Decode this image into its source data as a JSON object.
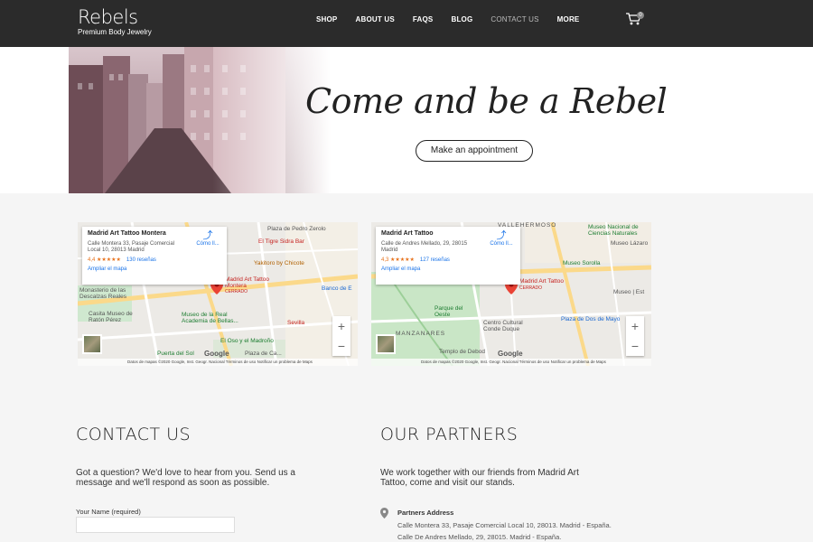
{
  "header": {
    "logo_main": "Rebels",
    "logo_sub": "Premium Body Jewelry",
    "nav": [
      "SHOP",
      "ABOUT US",
      "FAQS",
      "BLOG",
      "CONTACT US",
      "MORE"
    ],
    "active_nav": "CONTACT US",
    "cart_icon": "cart-icon",
    "cart_count": "0"
  },
  "hero": {
    "title": "Come and be a Rebel",
    "button": "Make an appointment"
  },
  "maps": [
    {
      "name": "Madrid Art Tattoo Montera",
      "address": "Calle Montera 33, Pasaje Comercial Local 10, 28013 Madrid",
      "rating": "4,4 ★★★★★",
      "reviews": "130 reseñas",
      "enlarge": "Ampliar el mapa",
      "directions": "Cómo ll...",
      "pin_label": "Madrid Art Tattoo Montera",
      "pin_status": "CERRADO",
      "places": [
        "Plaza de Pedro Zerolo",
        "El Tigre Sidra Bar",
        "Yakitoro by Chicote",
        "Banco de E",
        "Monasterio de las Descalzas Reales",
        "Casita Museo de Ratón Pérez",
        "Museo de la Real Academia de Bellas...",
        "Sevilla",
        "El Oso y el Madroño",
        "Puerta del Sol",
        "Plaza de Ca..."
      ],
      "footer": "Datos de mapas ©2020 Google, Inst. Geogr. Nacional    Términos de uso    Notificar un problema de Maps"
    },
    {
      "name": "Madrid Art Tattoo",
      "address": "Calle de Andres Mellado, 29, 28015 Madrid",
      "rating": "4,3 ★★★★★",
      "reviews": "127 reseñas",
      "enlarge": "Ampliar el mapa",
      "directions": "Cómo ll...",
      "pin_label": "Madrid Art Tattoo",
      "pin_status": "CERRADO",
      "places": [
        "VALLEHERMOSO",
        "Museo Nacional de Ciencias Naturales",
        "Museo Lázaro",
        "Museo Sorolla",
        "Museo | Est",
        "Parque del Oeste",
        "Centro Cultural Conde Duque",
        "Plaza de Dos de Mayo",
        "Templo de Debod",
        "MANZANARES"
      ],
      "footer": "Datos de mapas ©2020 Google, Inst. Geogr. Nacional    Términos de uso    Notificar un problema de Maps"
    }
  ],
  "contact": {
    "title": "CONTACT US",
    "text": "Got a question? We'd love to hear from you. Send us a message and we'll respond as soon as possible.",
    "name_label": "Your Name (required)",
    "name_value": ""
  },
  "partners": {
    "title": "OUR PARTNERS",
    "text": "We work together with our friends from Madrid Art Tattoo, come and visit our stands.",
    "address_head": "Partners Address",
    "address_1": "Calle Montera 33, Pasaje Comercial Local 10, 28013. Madrid - España.",
    "address_2": "Calle De Andres Mellado, 29, 28015. Madrid - España."
  },
  "google_logo": "Google",
  "colors": {
    "header_bg": "#2b2b2b",
    "page_bg": "#f5f5f5",
    "pin": "#ea4335",
    "link": "#1a73e8"
  }
}
